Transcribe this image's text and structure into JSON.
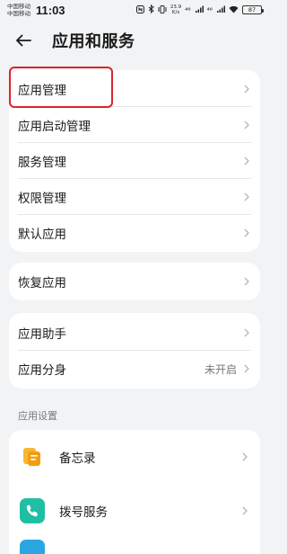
{
  "status_bar": {
    "carrier1": "中国移动",
    "carrier2": "中国移动",
    "time": "11:03",
    "net_speed": "23.9",
    "net_unit": "K/s",
    "signal1": "⁴⁶",
    "signal2": "⁴⁶",
    "battery": "87"
  },
  "header": {
    "title": "应用和服务"
  },
  "group1": [
    {
      "label": "应用管理"
    },
    {
      "label": "应用启动管理"
    },
    {
      "label": "服务管理"
    },
    {
      "label": "权限管理"
    },
    {
      "label": "默认应用"
    }
  ],
  "group2": [
    {
      "label": "恢复应用"
    }
  ],
  "group3": [
    {
      "label": "应用助手",
      "value": ""
    },
    {
      "label": "应用分身",
      "value": "未开启"
    }
  ],
  "section_title": "应用设置",
  "app_settings": [
    {
      "label": "备忘录",
      "icon": "notes-icon",
      "color": "#f5a623"
    },
    {
      "label": "拨号服务",
      "icon": "phone-icon",
      "color": "#1fbfa4"
    }
  ],
  "colors": {
    "highlight": "#d9262b",
    "background": "#f1f3f5"
  }
}
